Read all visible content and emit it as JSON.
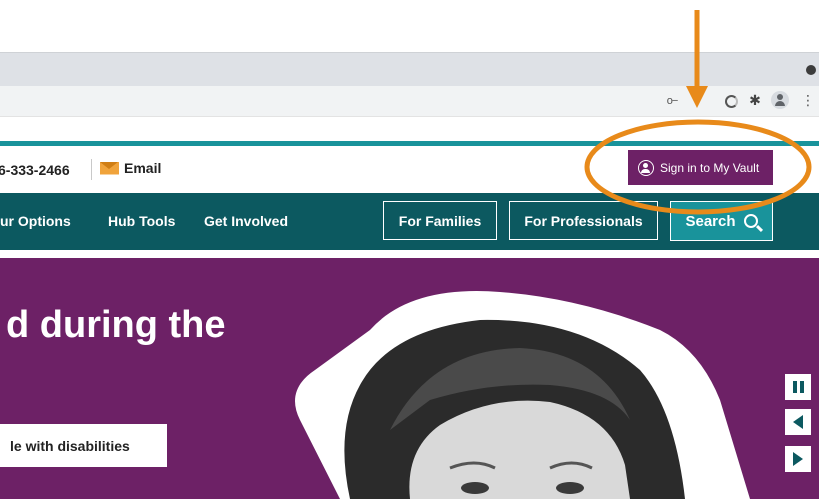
{
  "utility": {
    "phone": "6-333-2466",
    "email_label": "Email",
    "signin_label": "Sign in to My Vault"
  },
  "nav": {
    "links": [
      "ur Options",
      "Hub Tools",
      "Get Involved"
    ],
    "buttons": [
      "For Families",
      "For Professionals"
    ],
    "search_label": "Search"
  },
  "hero": {
    "heading": "d during the",
    "button_label": "le with disabilities"
  },
  "colors": {
    "teal": "#19939b",
    "dark_teal": "#0c5960",
    "purple": "#6d2166",
    "orange": "#e88a1a"
  }
}
